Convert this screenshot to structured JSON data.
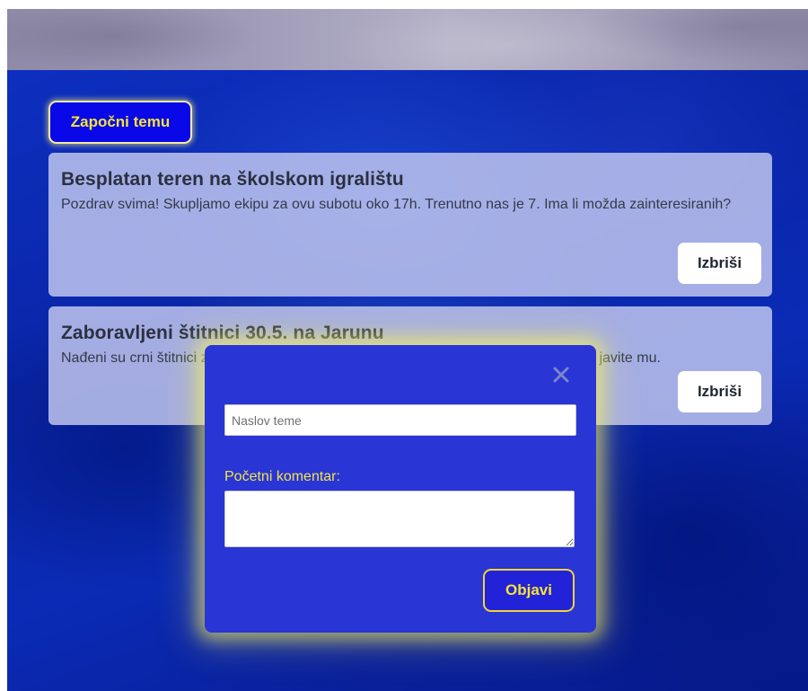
{
  "toolbar": {
    "start_topic_label": "Započni temu"
  },
  "topics": [
    {
      "title": "Besplatan teren na školskom igralištu",
      "text": "Pozdrav svima! Skupljamo ekipu za ovu subotu oko 17h. Trenutno nas je 7. Ima li možda zainteresiranih?",
      "delete_label": "Izbriši"
    },
    {
      "title": "Zaboravljeni štitnici 30.5. na Jarunu",
      "text": "Nađeni su crni štitnici za potkoljenicu nakon utakmice na Jarunu. Ako znate vlasnika javite mu.",
      "delete_label": "Izbriši"
    }
  ],
  "modal": {
    "title_placeholder": "Naslov teme",
    "comment_label": "Početni komentar:",
    "comment_value": "",
    "post_label": "Objavi",
    "close_icon": "close-icon"
  },
  "colors": {
    "accent_yellow": "#f5e33a",
    "button_blue": "#0808e8",
    "modal_blue": "#2a35d6",
    "card_bg": "#bec4ee"
  }
}
